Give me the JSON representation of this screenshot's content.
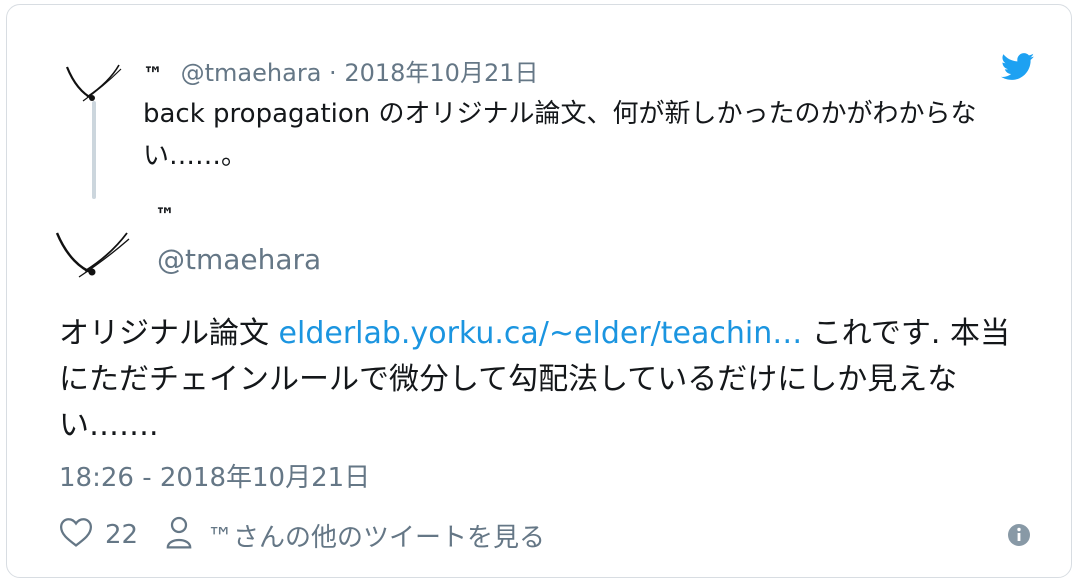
{
  "parent_tweet": {
    "display_name": "™",
    "handle": "@tmaehara",
    "separator": "·",
    "date": "2018年10月21日",
    "text": "back propagation のオリジナル論文、何が新しかったのかがわからない……。"
  },
  "main_tweet": {
    "display_name": "™",
    "handle": "@tmaehara",
    "text_prefix": "オリジナル論文 ",
    "link_text": "elderlab.yorku.ca/~elder/teachin…",
    "text_suffix": " これです. 本当にただチェインルールで微分して勾配法しているだけにしか見えない…….",
    "timestamp": "18:26 - 2018年10月21日"
  },
  "actions": {
    "like_count": "22",
    "more_tweets_label": "™さんの他のツイートを見る"
  },
  "colors": {
    "link": "#1b95e0",
    "muted": "#657786",
    "twitter_blue": "#1da1f2",
    "thread_line": "#ccd6dd"
  },
  "icons": [
    "avatar-icon",
    "twitter-bird-icon",
    "heart-icon",
    "person-icon",
    "info-icon"
  ]
}
